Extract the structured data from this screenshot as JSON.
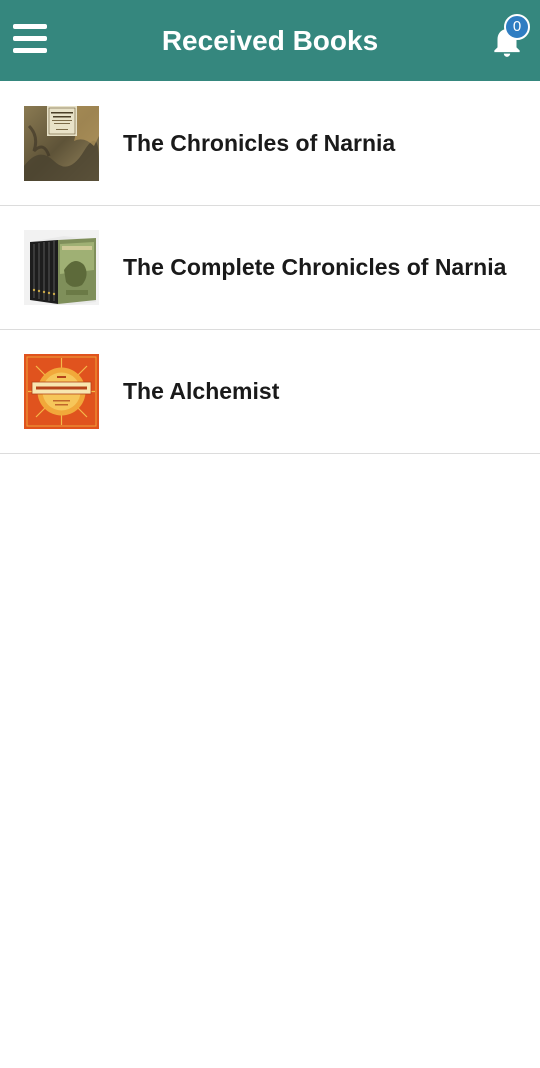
{
  "header": {
    "title": "Received Books",
    "notification_count": "0"
  },
  "icons": {
    "menu": "hamburger-menu-icon",
    "notifications": "bell-icon"
  },
  "colors": {
    "appbar": "#35877e",
    "badge": "#2f7dc2"
  },
  "books": [
    {
      "title": "The Chronicles of Narnia",
      "cover": "narnia-cover"
    },
    {
      "title": "The Complete Chronicles of Narnia",
      "cover": "narnia-box-set-cover"
    },
    {
      "title": "The Alchemist",
      "cover": "alchemist-cover"
    }
  ]
}
